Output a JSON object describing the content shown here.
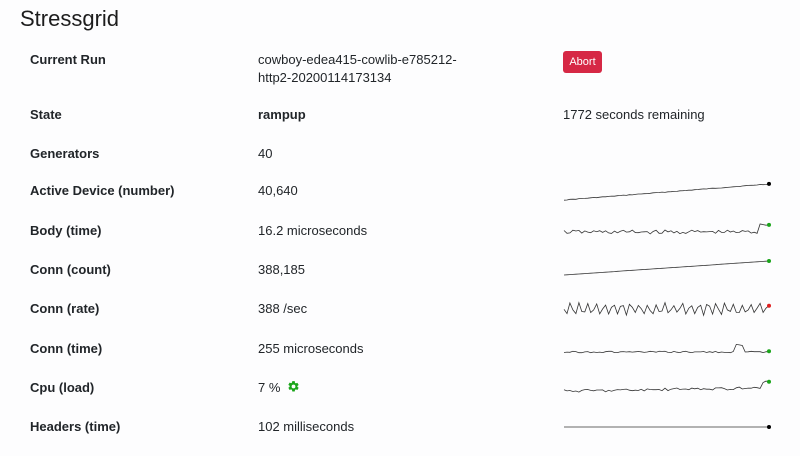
{
  "app": {
    "title": "Stressgrid"
  },
  "current_run": {
    "label": "Current Run",
    "value_line1": "cowboy-edea415-cowlib-e785212-",
    "value_line2": "http2-20200114173134",
    "abort_label": "Abort"
  },
  "state": {
    "label": "State",
    "value": "rampup",
    "remaining": "1772 seconds remaining"
  },
  "generators": {
    "label": "Generators",
    "value": "40"
  },
  "metrics": [
    {
      "label": "Active Device (number)",
      "value": "40,640",
      "dot_color": "#000000"
    },
    {
      "label": "Body (time)",
      "value": "16.2 microseconds",
      "dot_color": "#1aa51a"
    },
    {
      "label": "Conn (count)",
      "value": "388,185",
      "dot_color": "#1aa51a"
    },
    {
      "label": "Conn (rate)",
      "value": "388 /sec",
      "dot_color": "#e02020"
    },
    {
      "label": "Conn (time)",
      "value": "255 microseconds",
      "dot_color": "#1aa51a"
    },
    {
      "label": "Cpu (load)",
      "value": "7 %",
      "dot_color": "#1aa51a",
      "icon": "gear-icon",
      "icon_color": "#1aa51a"
    },
    {
      "label": "Headers (time)",
      "value": "102 milliseconds",
      "dot_color": "#000000"
    }
  ]
}
